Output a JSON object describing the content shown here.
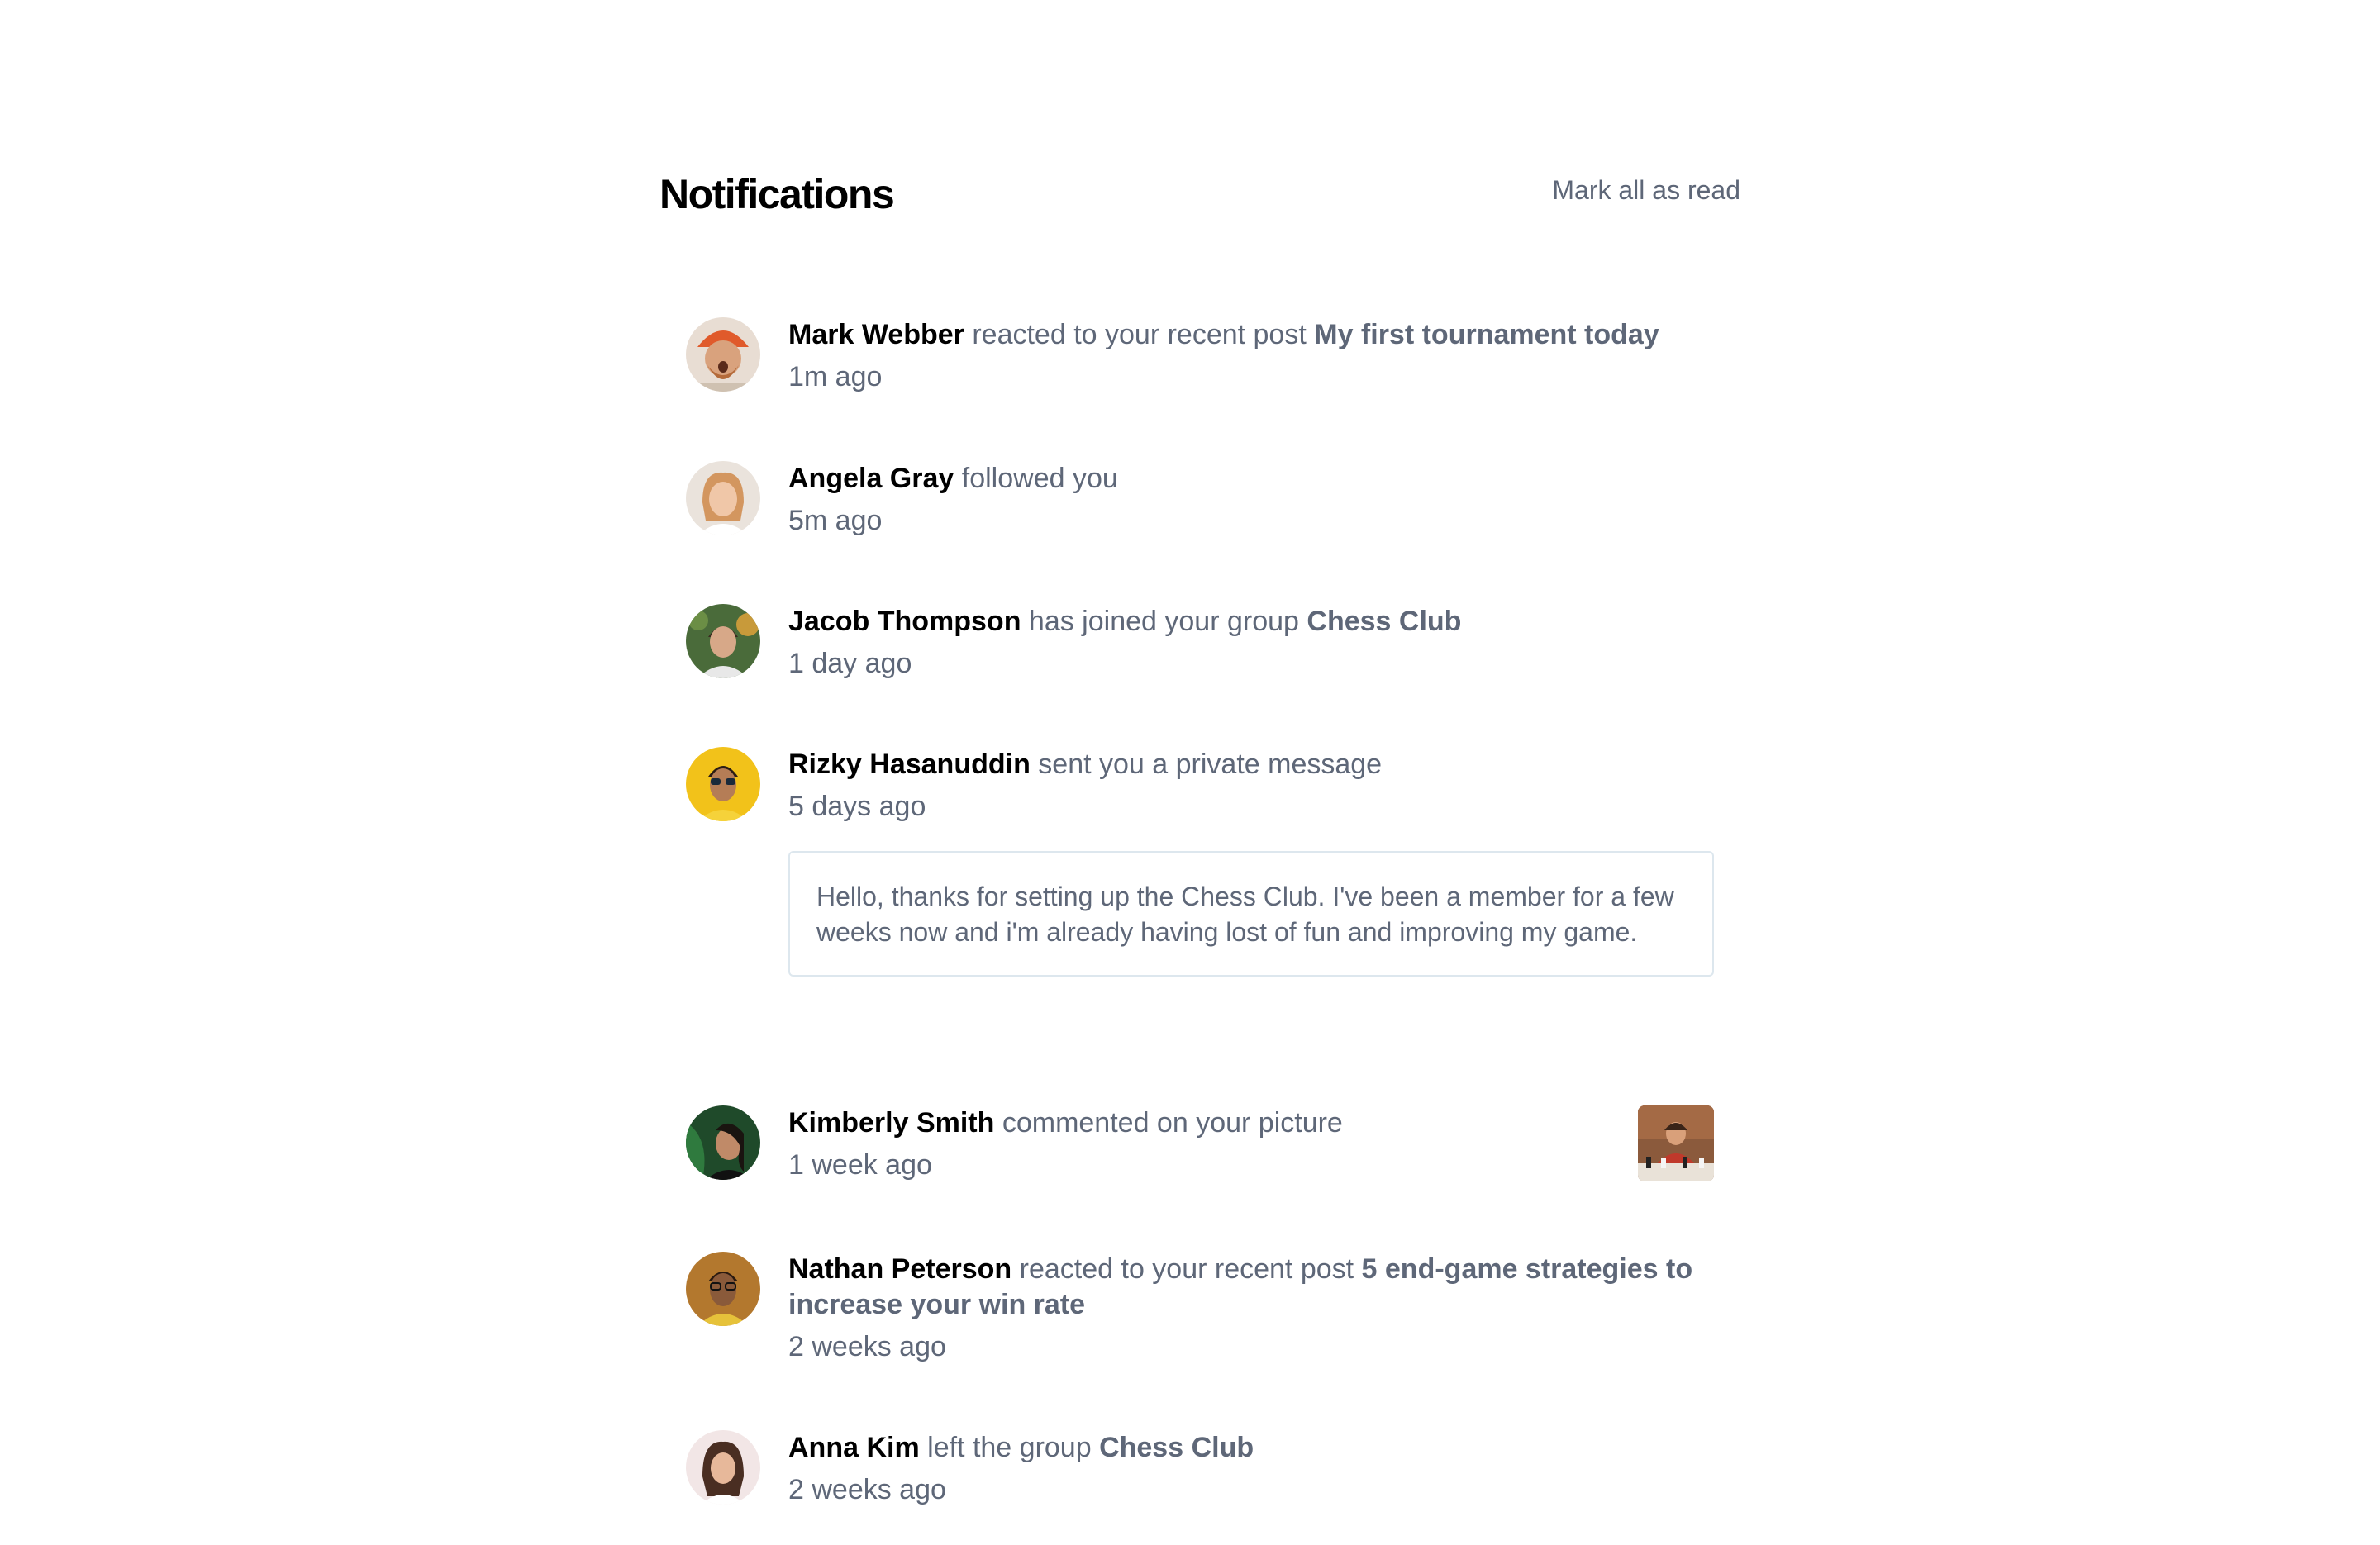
{
  "header": {
    "title": "Notifications",
    "mark_all_label": "Mark all as read"
  },
  "notifications": [
    {
      "name": "Mark Webber",
      "action": "reacted to your recent post",
      "target": "My first tournament today",
      "time": "1m ago",
      "avatar_icon": "avatar-mark-webber"
    },
    {
      "name": "Angela Gray",
      "action": "followed you",
      "target": "",
      "time": "5m ago",
      "avatar_icon": "avatar-angela-gray"
    },
    {
      "name": "Jacob Thompson",
      "action": "has joined your group",
      "target": "Chess Club",
      "time": "1 day ago",
      "avatar_icon": "avatar-jacob-thompson"
    },
    {
      "name": "Rizky Hasanuddin",
      "action": "sent you a private message",
      "target": "",
      "time": "5 days ago",
      "message": "Hello, thanks for setting up the Chess Club. I've been a member for a few weeks now and i'm already having lost of fun and improving my game.",
      "avatar_icon": "avatar-rizky-hasanuddin"
    },
    {
      "name": "Kimberly Smith",
      "action": "commented on your picture",
      "target": "",
      "time": "1 week ago",
      "picture_icon": "chess-picture-thumbnail",
      "avatar_icon": "avatar-kimberly-smith"
    },
    {
      "name": "Nathan Peterson",
      "action": "reacted to your recent post",
      "target": "5 end-game strategies to increase your win rate",
      "time": "2 weeks ago",
      "avatar_icon": "avatar-nathan-peterson"
    },
    {
      "name": "Anna Kim",
      "action": "left the group",
      "target": "Chess Club",
      "time": "2 weeks ago",
      "avatar_icon": "avatar-anna-kim"
    }
  ],
  "colors": {
    "heading": "#000000",
    "text": "#5e6778",
    "border": "#dde7ee"
  }
}
